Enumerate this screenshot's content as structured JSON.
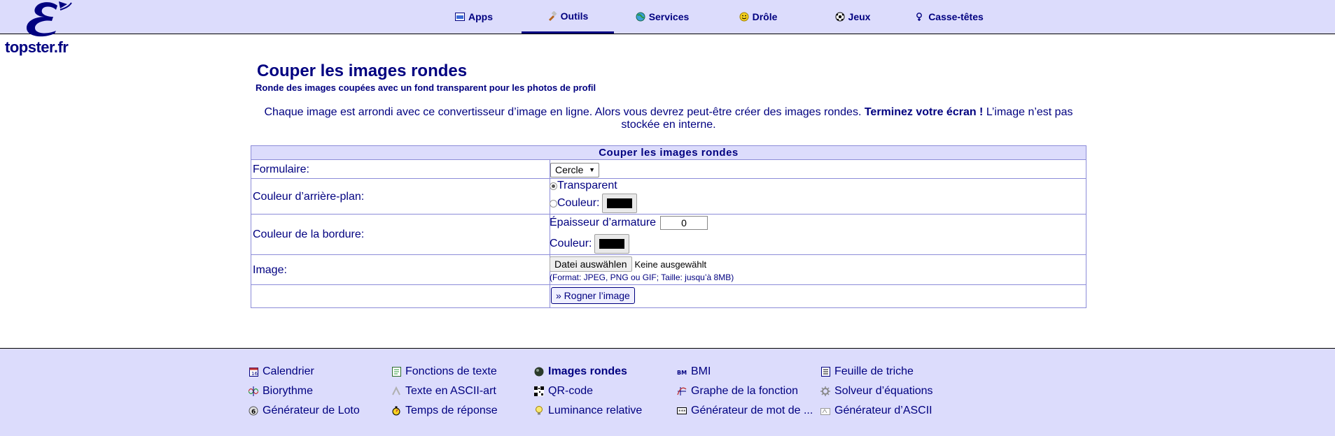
{
  "site": {
    "logo_text": "topster.fr"
  },
  "nav": [
    {
      "label": "Apps",
      "icon": "apps-icon"
    },
    {
      "label": "Outils",
      "icon": "tools-icon"
    },
    {
      "label": "Services",
      "icon": "globe-icon"
    },
    {
      "label": "Drôle",
      "icon": "smiley-icon"
    },
    {
      "label": "Jeux",
      "icon": "soccer-ball-icon"
    },
    {
      "label": "Casse-têtes",
      "icon": "puzzle-icon"
    }
  ],
  "page": {
    "title": "Couper les images rondes",
    "subtitle": "Ronde des images coupées avec un fond transparent pour les photos de profil",
    "intro_part1": "Chaque image est arrondi avec ce convertisseur d’image en ligne. Alors vous devrez peut-être créer des images rondes.",
    "intro_bold": "Terminez votre écran !",
    "intro_part2": "L’image n’est pas stockée en interne."
  },
  "form": {
    "header": "Couper les images rondes",
    "shape_label": "Formulaire:",
    "shape_value": "Cercle",
    "bg_label": "Couleur d’arrière-plan:",
    "bg_transparent": "Transparent",
    "bg_color": "Couleur:",
    "border_label": "Couleur de la bordure:",
    "border_thickness_label": "Épaisseur d’armature",
    "border_thickness_value": "0",
    "border_color": "Couleur:",
    "image_label": "Image:",
    "file_button": "Datei auswählen",
    "file_status": "Keine ausgewählt",
    "file_hint": "(Format: JPEG, PNG ou GIF; Taille: jusqu’à 8MB)",
    "submit": "» Rogner l’image",
    "swatch_color": "#000000"
  },
  "footer": {
    "col1": [
      {
        "label": "Calendrier",
        "icon": "calendar-icon"
      },
      {
        "label": "Biorythme",
        "icon": "biorhythm-icon"
      },
      {
        "label": "Générateur de Loto",
        "icon": "lotto-ball-icon"
      }
    ],
    "col2": [
      {
        "label": "Fonctions de texte",
        "icon": "text-functions-icon"
      },
      {
        "label": "Texte en ASCII-art",
        "icon": "ascii-art-icon"
      },
      {
        "label": "Temps de réponse",
        "icon": "stopwatch-icon"
      }
    ],
    "col3": [
      {
        "label": "Images rondes",
        "icon": "round-image-icon"
      },
      {
        "label": "QR-code",
        "icon": "qr-code-icon"
      },
      {
        "label": "Luminance relative",
        "icon": "lightbulb-icon"
      }
    ],
    "col4": [
      {
        "label": "BMI",
        "icon": "bmi-icon"
      },
      {
        "label": "Graphe de la fonction",
        "icon": "function-graph-icon"
      },
      {
        "label": "Générateur de mot de ...",
        "icon": "password-icon"
      }
    ],
    "col5": [
      {
        "label": "Feuille de triche",
        "icon": "cheat-sheet-icon"
      },
      {
        "label": "Solveur d’équations",
        "icon": "equation-solver-icon"
      },
      {
        "label": "Générateur d’ASCII",
        "icon": "ascii-generator-icon"
      }
    ]
  },
  "colors": {
    "brand": "#000080",
    "header_bg": "#dcdcfc",
    "border": "#8c8cd8"
  }
}
